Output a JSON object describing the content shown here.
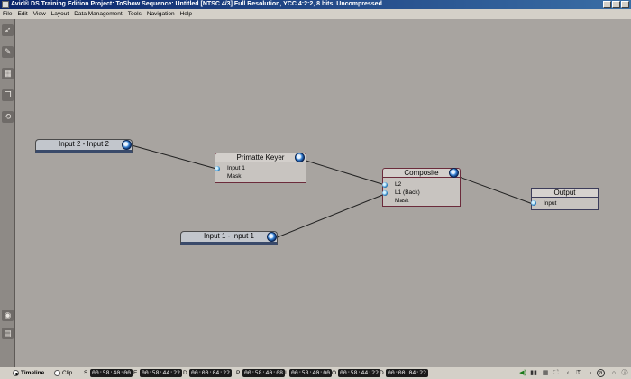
{
  "window": {
    "title": "Avid® DS Training Edition Project: ToShow    Sequence: Untitled    [NTSC 4/3]  Full Resolution, YCC 4:2:2, 8 bits, Uncompressed"
  },
  "menu": [
    "File",
    "Edit",
    "View",
    "Layout",
    "Data Management",
    "Tools",
    "Navigation",
    "Help"
  ],
  "left_tools": [
    "pointer-tool-icon",
    "paint-tool-icon",
    "grid-tool-icon",
    "layers-tool-icon",
    "rotate-tool-icon",
    "settings-tool-icon",
    "view-tool-icon"
  ],
  "nodes": {
    "input2": {
      "title": "Input 2 - Input 2"
    },
    "input1": {
      "title": "Input 1 - Input 1"
    },
    "primatte": {
      "title": "Primatte Keyer",
      "ports": [
        "Input 1",
        "Mask"
      ]
    },
    "composite": {
      "title": "Composite",
      "ports": [
        "L2",
        "L1 (Back)",
        "Mask"
      ]
    },
    "output": {
      "title": "Output",
      "ports": [
        "Input"
      ]
    }
  },
  "status": {
    "timeline_label": "Timeline",
    "clip_label": "Clip",
    "timecodes": [
      {
        "label": "S",
        "value": "00:58:40:00"
      },
      {
        "label": "E",
        "value": "00:58:44:22"
      },
      {
        "label": "D",
        "value": "00:00:04:22"
      },
      {
        "label": "P",
        "value": "00:58:40:08"
      },
      {
        "label": "I",
        "value": "00:58:40:00"
      },
      {
        "label": "O",
        "value": "00:58:44:22"
      },
      {
        "label": "D",
        "value": "00:00:04:22"
      }
    ]
  },
  "colors": {
    "canvas": "#a8a4a0",
    "effect_border": "#6b2b3b",
    "port_blue": "#3a86d8"
  }
}
